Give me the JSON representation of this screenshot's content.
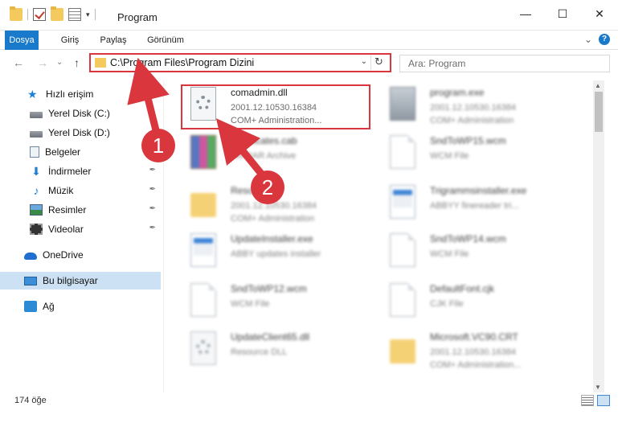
{
  "window": {
    "title": "Program",
    "minimize": "—",
    "maximize": "☐",
    "close": "✕"
  },
  "ribbon": {
    "tabs": [
      "Dosya",
      "Giriş",
      "Paylaş",
      "Görünüm"
    ],
    "expand": "⌄",
    "help": "?"
  },
  "nav": {
    "back": "←",
    "forward": "→",
    "recent": "⌄",
    "up": "↑",
    "address": "C:\\Program Files\\Program Dizini",
    "address_dropdown": "⌄",
    "refresh": "↻",
    "search_placeholder": "Ara: Program"
  },
  "sidebar": {
    "items": [
      {
        "label": "Hızlı erişim",
        "icon": "star-icon"
      },
      {
        "label": "Yerel Disk (C:)",
        "icon": "disk-icon"
      },
      {
        "label": "Yerel Disk (D:)",
        "icon": "disk-icon"
      },
      {
        "label": "Belgeler",
        "icon": "document-icon"
      },
      {
        "label": "İndirmeler",
        "icon": "download-icon",
        "pinned": true
      },
      {
        "label": "Müzik",
        "icon": "music-icon",
        "pinned": true
      },
      {
        "label": "Resimler",
        "icon": "pictures-icon",
        "pinned": true
      },
      {
        "label": "Videolar",
        "icon": "videos-icon",
        "pinned": true
      },
      {
        "label": "OneDrive",
        "icon": "onedrive-icon"
      },
      {
        "label": "Bu bilgisayar",
        "icon": "this-pc-icon",
        "selected": true
      },
      {
        "label": "Ağ",
        "icon": "network-icon"
      }
    ],
    "pin_glyph": "📌"
  },
  "files": [
    {
      "name": "comadmin.dll",
      "line1": "2001.12.10530.16384",
      "line2": "COM+ Administration...",
      "icon": "dll-gear-icon"
    },
    {
      "name": "program.exe",
      "line1": "2001.12.10530.16384",
      "line2": "COM+ Administration",
      "icon": "exe-icon"
    },
    {
      "name": "Certificates.cab",
      "line1": "WinRAR Archive",
      "line2": "",
      "icon": "winrar-icon"
    },
    {
      "name": "SndToWP15.wcm",
      "line1": "WCM File",
      "line2": "",
      "icon": "file-icon"
    },
    {
      "name": "Resources",
      "line1": "2001.12.10530.16384",
      "line2": "COM+ Administration",
      "icon": "folder-icon"
    },
    {
      "name": "Trigrammsinstaller.exe",
      "line1": "ABBYY finereader tri...",
      "line2": "",
      "icon": "installer-icon"
    },
    {
      "name": "UpdateInstaller.exe",
      "line1": "ABBY updates installer",
      "line2": "",
      "icon": "installer-icon"
    },
    {
      "name": "SndToWP14.wcm",
      "line1": "WCM File",
      "line2": "",
      "icon": "file-icon"
    },
    {
      "name": "SndToWP12.wcm",
      "line1": "WCM File",
      "line2": "",
      "icon": "file-icon"
    },
    {
      "name": "DefaultFont.cjk",
      "line1": "CJK File",
      "line2": "",
      "icon": "file-icon"
    },
    {
      "name": "UpdateClient65.dll",
      "line1": "Resource DLL",
      "line2": "",
      "icon": "dll-gear-icon"
    },
    {
      "name": "Microsoft.VC90.CRT",
      "line1": "2001.12.10530.16384",
      "line2": "COM+ Administration...",
      "icon": "folder-icon"
    }
  ],
  "status": {
    "count": "174 öğe"
  },
  "annotations": {
    "badge1": "1",
    "badge2": "2",
    "color": "#d9363e"
  },
  "colors": {
    "accent": "#1979ca",
    "selection": "#cce1f3",
    "highlight": "#d9363e"
  }
}
